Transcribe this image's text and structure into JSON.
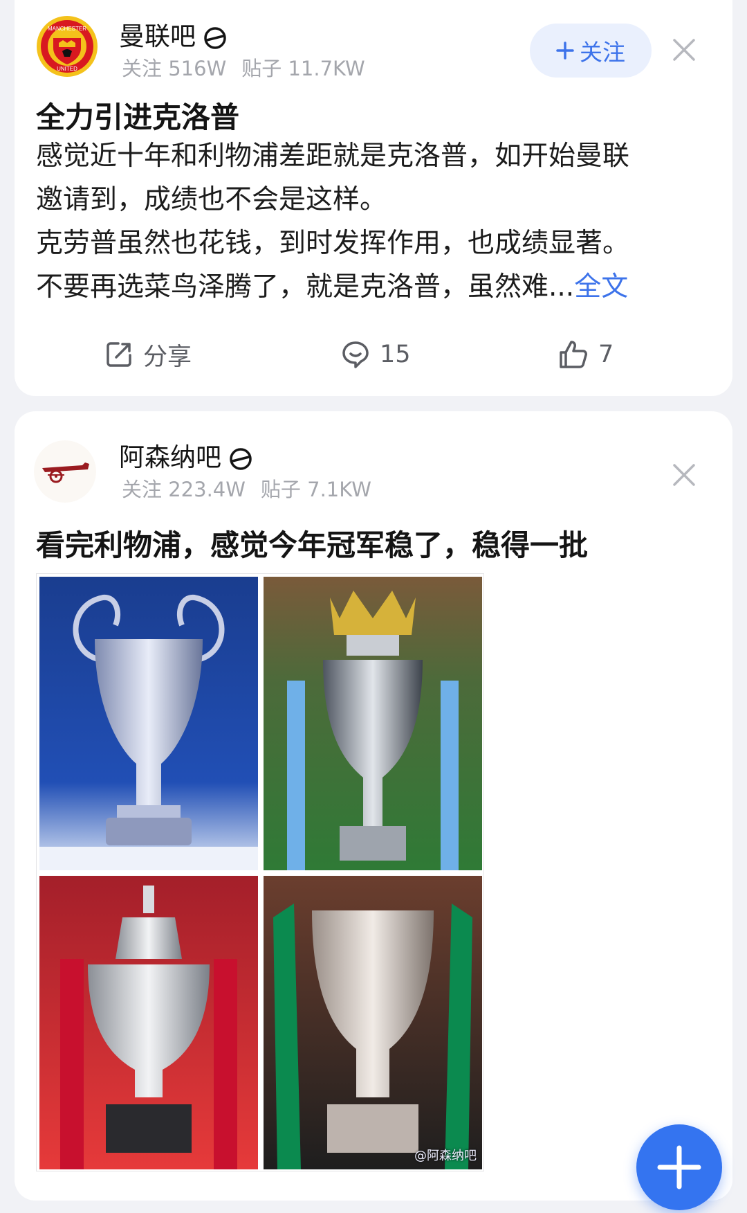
{
  "posts": [
    {
      "forum_name": "曼联吧",
      "followers": "关注 516W",
      "posts_count": "贴子 11.7KW",
      "follow_label": "关注",
      "title": "全力引进克洛普",
      "body_lines": [
        "感觉近十年和利物浦差距就是克洛普，如开始曼联",
        "邀请到，成绩也不会是这样。",
        "克劳普虽然也花钱，到时发挥作用，也成绩显著。",
        "不要再选菜鸟泽腾了，就是克洛普，虽然难..."
      ],
      "full_text_link": "全文",
      "share_label": "分享",
      "comment_count": "15",
      "like_count": "7"
    },
    {
      "forum_name": "阿森纳吧",
      "followers": "关注 223.4W",
      "posts_count": "贴子 7.1KW",
      "title": "看完利物浦，感觉今年冠军稳了，稳得一批",
      "watermark": "@阿森纳吧"
    }
  ],
  "colors": {
    "accent": "#3d73ea",
    "fab": "#3474f0",
    "card": "#ffffff",
    "background": "#f1f2f6"
  }
}
